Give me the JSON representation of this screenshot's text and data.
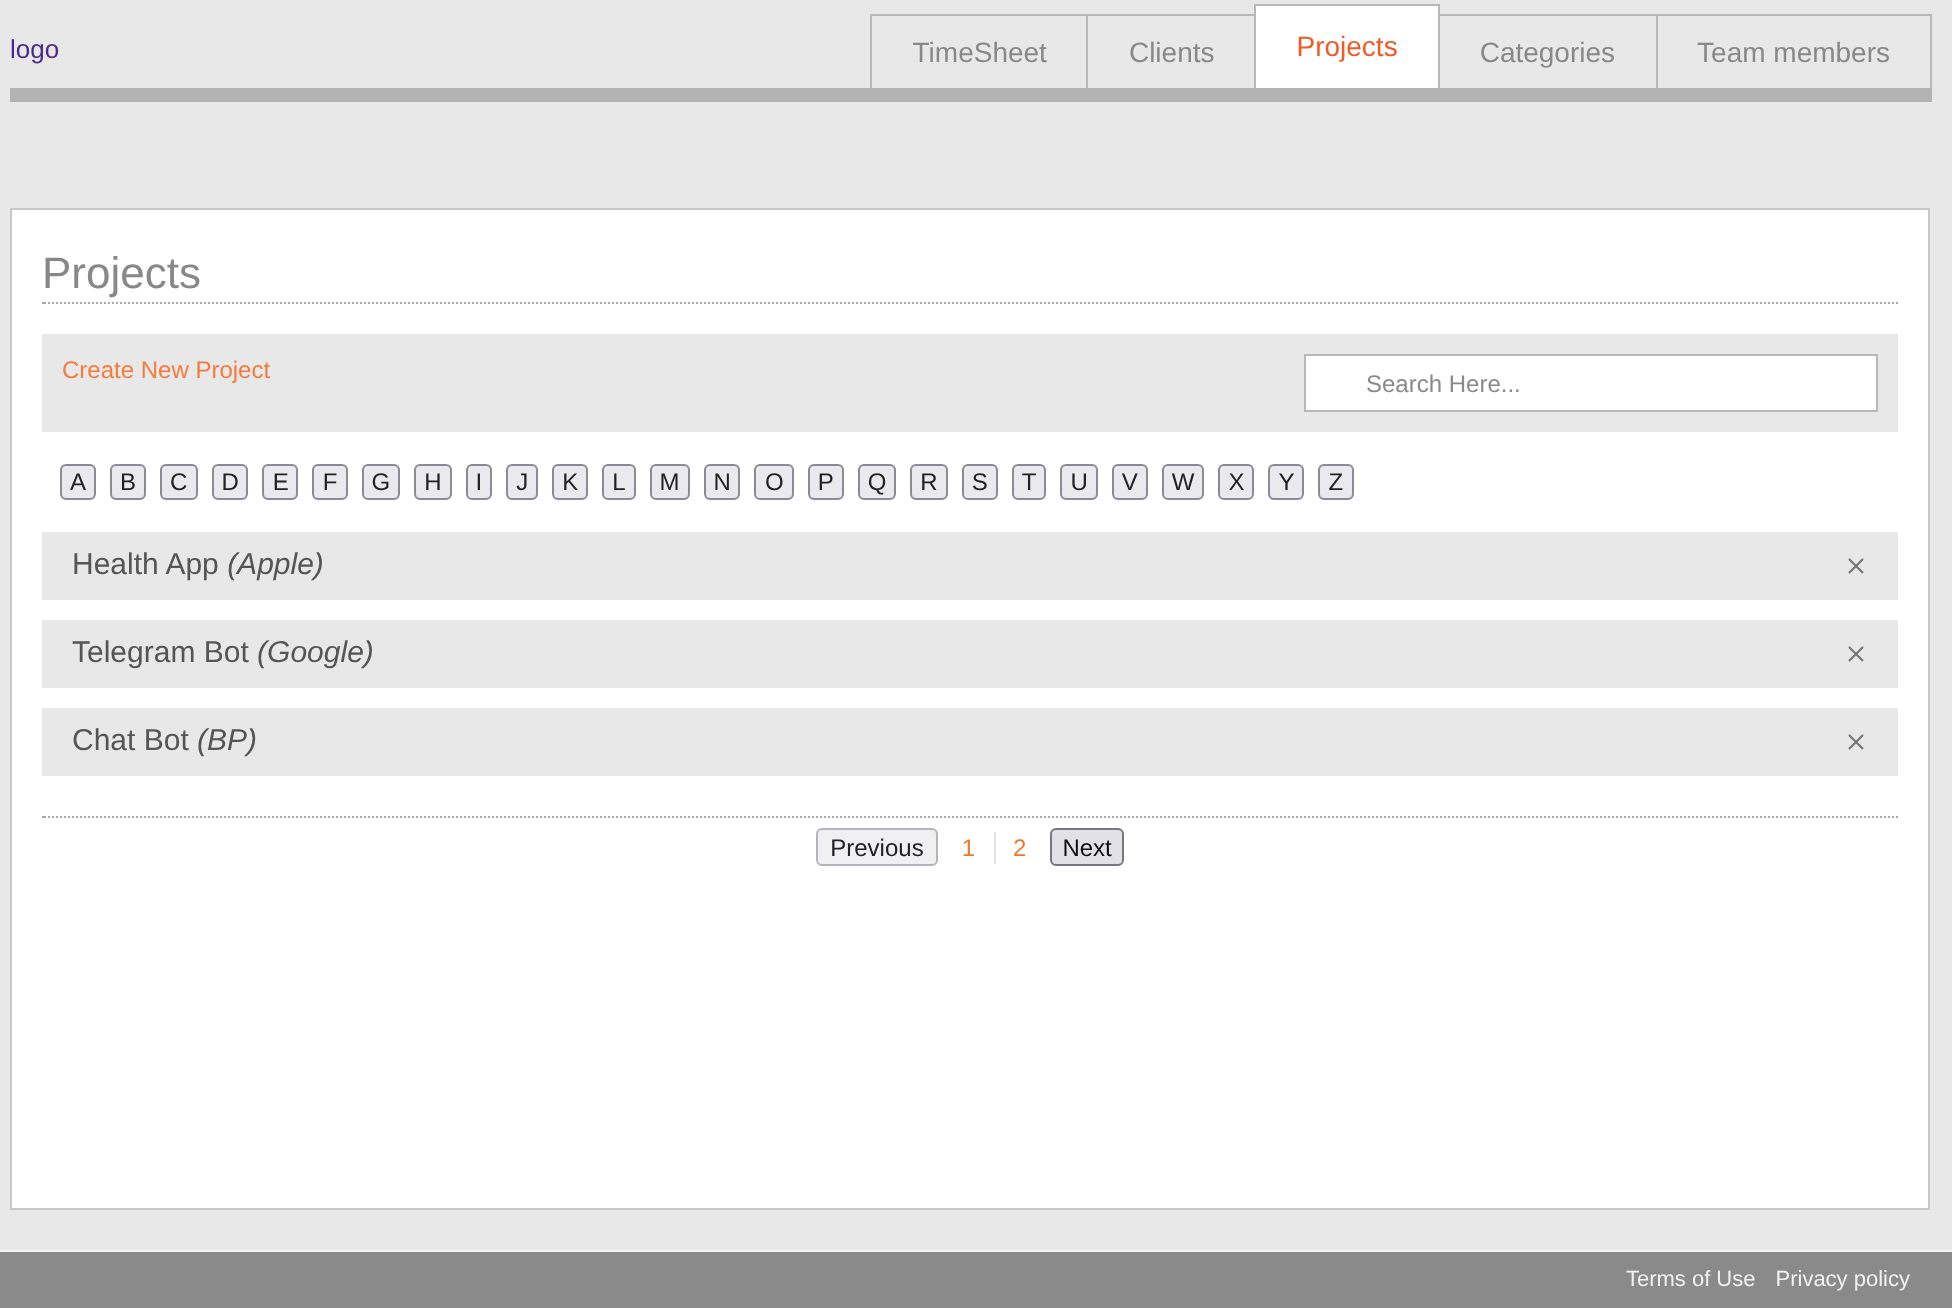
{
  "header": {
    "logo": "logo"
  },
  "tabs": [
    {
      "label": "TimeSheet",
      "selected": false
    },
    {
      "label": "Clients",
      "selected": false
    },
    {
      "label": "Projects",
      "selected": true
    },
    {
      "label": "Categories",
      "selected": false
    },
    {
      "label": "Team members",
      "selected": false
    }
  ],
  "page": {
    "title": "Projects",
    "create_link": "Create New Project",
    "search": {
      "placeholder": "Search Here..."
    }
  },
  "letters": [
    "A",
    "B",
    "C",
    "D",
    "E",
    "F",
    "G",
    "H",
    "I",
    "J",
    "K",
    "L",
    "M",
    "N",
    "O",
    "P",
    "Q",
    "R",
    "S",
    "T",
    "U",
    "V",
    "W",
    "X",
    "Y",
    "Z"
  ],
  "projects": [
    {
      "title": "Health App *(Apple)*"
    },
    {
      "title": "Telegram Bot *(Google)*"
    },
    {
      "title": "Chat Bot *(BP)*"
    }
  ],
  "pagination": {
    "previous": {
      "label": "Previous",
      "disabled": true
    },
    "pages": [
      "1",
      "2"
    ],
    "next": {
      "label": "Next",
      "disabled": false
    }
  },
  "footer": {
    "links": [
      "Terms of Use",
      "Privacy policy"
    ]
  }
}
